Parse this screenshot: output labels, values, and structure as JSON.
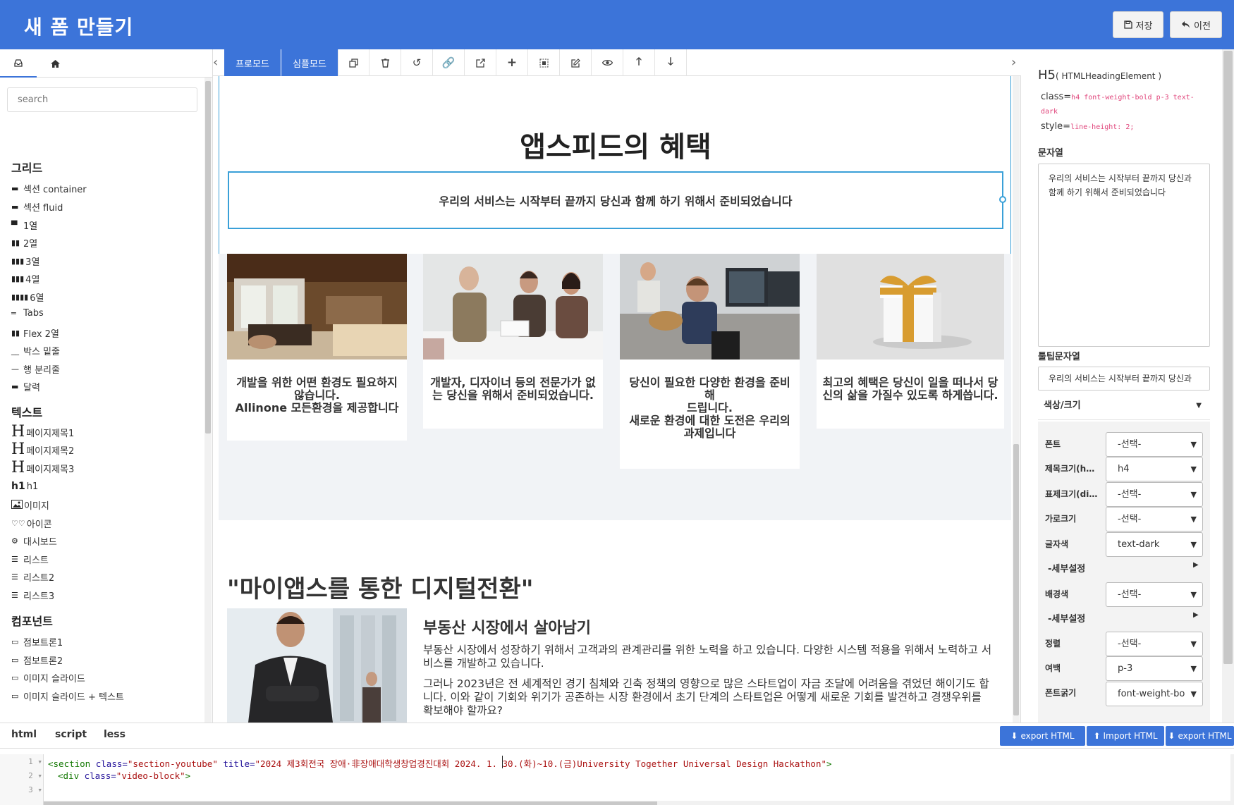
{
  "header": {
    "title": "새 폼 만들기",
    "save_label": "저장",
    "prev_label": "이전",
    "bg_color": "#3c74d9"
  },
  "left_panel": {
    "tab_icons": [
      "inbox-icon",
      "home-icon"
    ],
    "search_placeholder": "search",
    "sections": [
      {
        "title": "그리드",
        "items": [
          "섹션 container",
          "섹션 fluid",
          "1열",
          "2열",
          "3열",
          "4열",
          "6열",
          "Tabs",
          "Flex 2열",
          "박스 밑줄",
          "행 분리줄",
          "달력"
        ]
      },
      {
        "title": "텍스트",
        "items": [
          "페이지제목1",
          "페이지제목2",
          "페이지제목3",
          "h1",
          "이미지",
          "아이콘",
          "대시보드",
          "리스트",
          "리스트2",
          "리스트3"
        ]
      },
      {
        "title": "컴포넌트",
        "items": [
          "점보트론1",
          "점보트론2",
          "이미지 슬라이드",
          "이미지 슬라이드 + 텍스트"
        ]
      }
    ],
    "h1_glyph": "h1"
  },
  "toolbar": {
    "pro_mode": "프로모드",
    "simple_mode": "심플모드",
    "icons": [
      "copy-icon",
      "trash-icon",
      "undo-icon",
      "link-icon",
      "external-link-icon",
      "plus-icon",
      "select-box-icon",
      "edit-icon",
      "eye-icon",
      "arrow-up-icon",
      "arrow-down-icon"
    ]
  },
  "canvas": {
    "benefit_title": "앱스피드의 혜택",
    "benefit_sub": "우리의 서비스는 시작부터 끝까지 당신과 함께 하기 위해서 준비되었습니다",
    "cards": [
      {
        "line1": "개발을 위한 어떤 환경도 필요하지",
        "line2": "않습니다.",
        "line3": "Allinone 모든환경을 제공합니다",
        "line4": ""
      },
      {
        "line1": "개발자, 디자이너 등의 전문가가 없",
        "line2": "는 당신을 위해서 준비되었습니다.",
        "line3": "",
        "line4": ""
      },
      {
        "line1": "당신이 필요한 다양한 환경을 준비해",
        "line2": "드립니다.",
        "line3": "새로운 환경에 대한 도전은 우리의",
        "line4": "과제입니다"
      },
      {
        "line1": "최고의 혜택은 당신이 일을 떠나서 당",
        "line2": "신의 삶을 가질수 있도록 하게씁니다.",
        "line3": "",
        "line4": ""
      }
    ],
    "dx_title": "\"마이앱스를 통한 디지털전환\"",
    "s2_heading": "부동산 시장에서 살아남기",
    "s2_p1": "부동산 시장에서 성장하기 위해서 고객과의 관계관리를 위한 노력을 하고 있습니다. 다양한 시스템 적용을 위해서 노력하고 서비스를 개발하고 있습니다.",
    "s2_p2": "그러나 2023년은 전 세계적인 경기 침체와 긴축 정책의 영향으로 많은 스타트업이 자금 조달에 어려움을 겪었던 해이기도 합니다. 이와 같이 기회와 위기가 공존하는 시장 환경에서 초기 단계의 스타트업은 어떻게 새로운 기회를 발견하고 경쟁우위를 확보해야 할까요?"
  },
  "right_panel": {
    "tag": "H5",
    "tag_sub": "( HTMLHeadingElement )",
    "class_label": "class=",
    "class_value": "h4 font-weight-bold p-3 text-dark",
    "style_label": "style=",
    "style_value": "line-height: 2;",
    "text_label": "문자열",
    "text_value": "우리의 서비스는 시작부터 끝까지 당신과 함께 하기 위해서 준비되었습니다",
    "tooltip_label": "툴팁문자열",
    "tooltip_value": "우리의 서비스는 시작부터 끝까지 당신과",
    "colorsize_label": "색상/크기",
    "detail_label": "-세부설정",
    "props": {
      "font": {
        "label": "폰트",
        "value": "-선택-"
      },
      "heading_size": {
        "label": "제목크기(h…",
        "value": "h4"
      },
      "display_size": {
        "label": "표제크기(di…",
        "value": "-선택-"
      },
      "width": {
        "label": "가로크기",
        "value": "-선택-"
      },
      "text_color": {
        "label": "글자색",
        "value": "text-dark"
      },
      "bg_color": {
        "label": "배경색",
        "value": "-선택-"
      },
      "align": {
        "label": "정렬",
        "value": "-선택-"
      },
      "padding": {
        "label": "여백",
        "value": "p-3"
      },
      "font_weight": {
        "label": "폰트굵기",
        "value": "font-weight-bo"
      }
    }
  },
  "editor": {
    "tabs": [
      "html",
      "script",
      "less"
    ],
    "export_html": "export HTML",
    "import_html": "Import HTML",
    "export_html2": "export HTML",
    "line_numbers": [
      "1",
      "2",
      "3"
    ],
    "line1_tag_open": "<section",
    "line1_attr_class": " class=",
    "line1_val_class": "\"section-youtube\"",
    "line1_attr_title": " title=",
    "line1_val_title": "\"2024 제3회전국 장애·非장애대학생창업경진대회 2024. 1. 30.(화)~10.(금)University Together Universal Design Hackathon\"",
    "line1_close": ">",
    "line2_tag_open": "<div",
    "line2_attr_class": " class=",
    "line2_val_class": "\"video-block\"",
    "line2_close": ">"
  }
}
